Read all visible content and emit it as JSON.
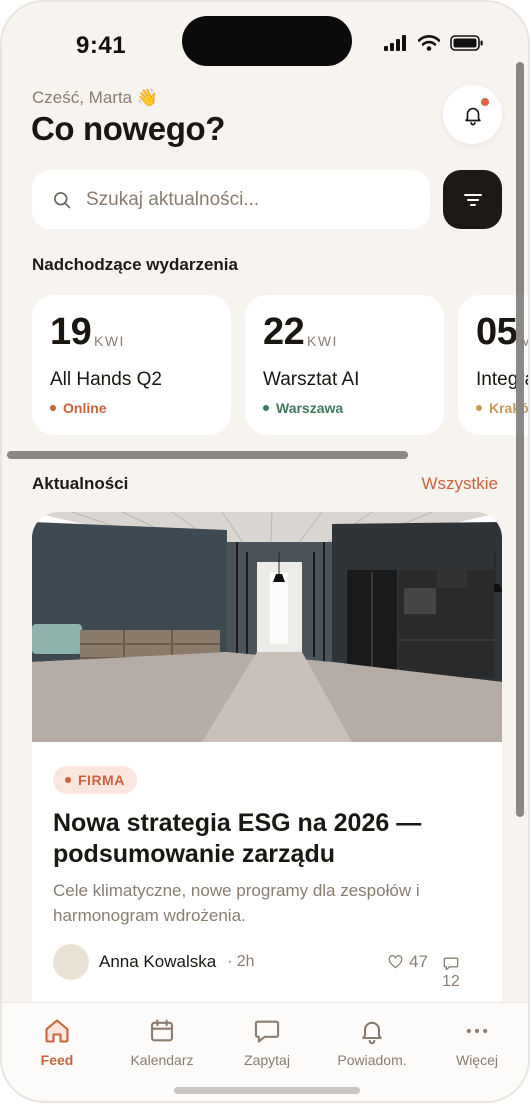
{
  "status_bar": {
    "time": "9:41"
  },
  "header": {
    "greeting": "Cześć, Marta 👋",
    "title": "Co nowego?",
    "notifications_icon": "bell-icon"
  },
  "search": {
    "placeholder": "Szukaj aktualności...",
    "value": ""
  },
  "events_section": {
    "title": "Nadchodzące wydarzenia",
    "items": [
      {
        "day": "19",
        "month": "KWI",
        "title": "All Hands Q2",
        "location": "Online",
        "color": "#c8643d"
      },
      {
        "day": "22",
        "month": "KWI",
        "title": "Warsztat AI",
        "location": "Warszawa",
        "color": "#3f7a5c"
      },
      {
        "day": "05",
        "month": "MAJ",
        "title": "Integracja",
        "location": "Kraków",
        "color": "#c49a5a"
      }
    ]
  },
  "news_section": {
    "title": "Aktualności",
    "see_all": "Wszystkie",
    "article": {
      "tag": "FIRMA",
      "title": "Nowa strategia ESG na 2026 — podsumowanie zarządu",
      "description": "Cele klimatyczne, nowe programy dla zespołów i harmonogram wdrożenia.",
      "author": "Anna Kowalska",
      "time": "· 2h",
      "likes": "47",
      "comments": "12"
    }
  },
  "tab_bar": {
    "items": [
      {
        "label": "Feed",
        "icon": "home-icon",
        "active": true
      },
      {
        "label": "Kalendarz",
        "icon": "calendar-icon",
        "active": false
      },
      {
        "label": "Zapytaj",
        "icon": "chat-icon",
        "active": false
      },
      {
        "label": "Powiadom.",
        "icon": "bell-icon",
        "active": false
      },
      {
        "label": "Więcej",
        "icon": "more-icon",
        "active": false
      }
    ]
  },
  "colors": {
    "accent": "#c8643d",
    "background": "#f7f3ee",
    "dark": "#1d1915"
  }
}
